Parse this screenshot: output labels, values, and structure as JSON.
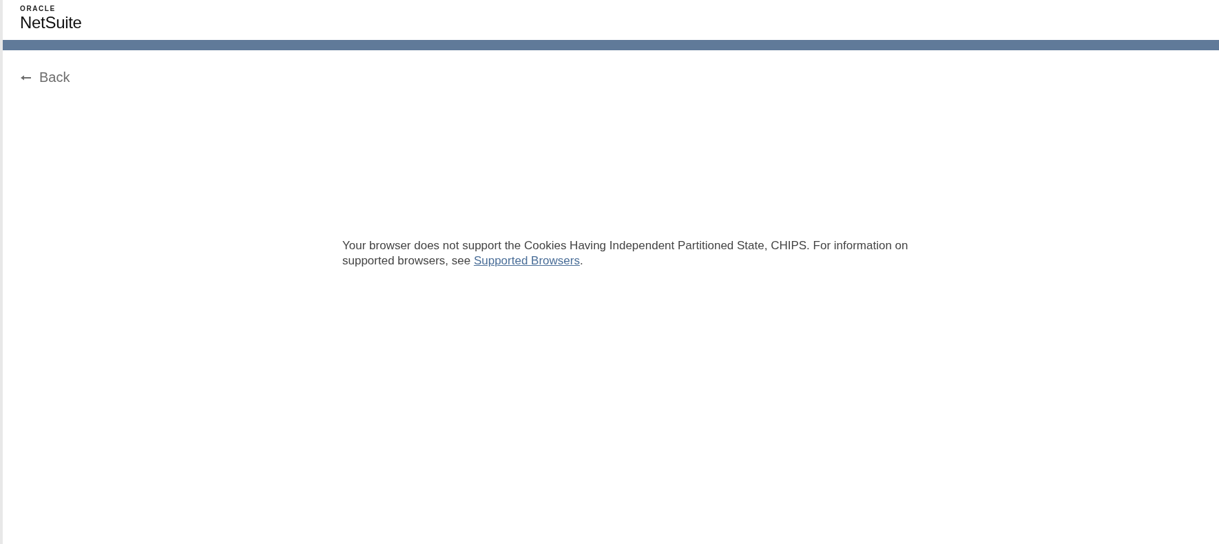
{
  "header": {
    "brand_top": "ORACLE",
    "brand_name": "NetSuite"
  },
  "back_link": {
    "label": "Back"
  },
  "message": {
    "text": "Your browser does not support the Cookies Having Independent Partitioned State, CHIPS. For information on supported browsers, see ",
    "link": "Supported Browsers",
    "after": "."
  }
}
